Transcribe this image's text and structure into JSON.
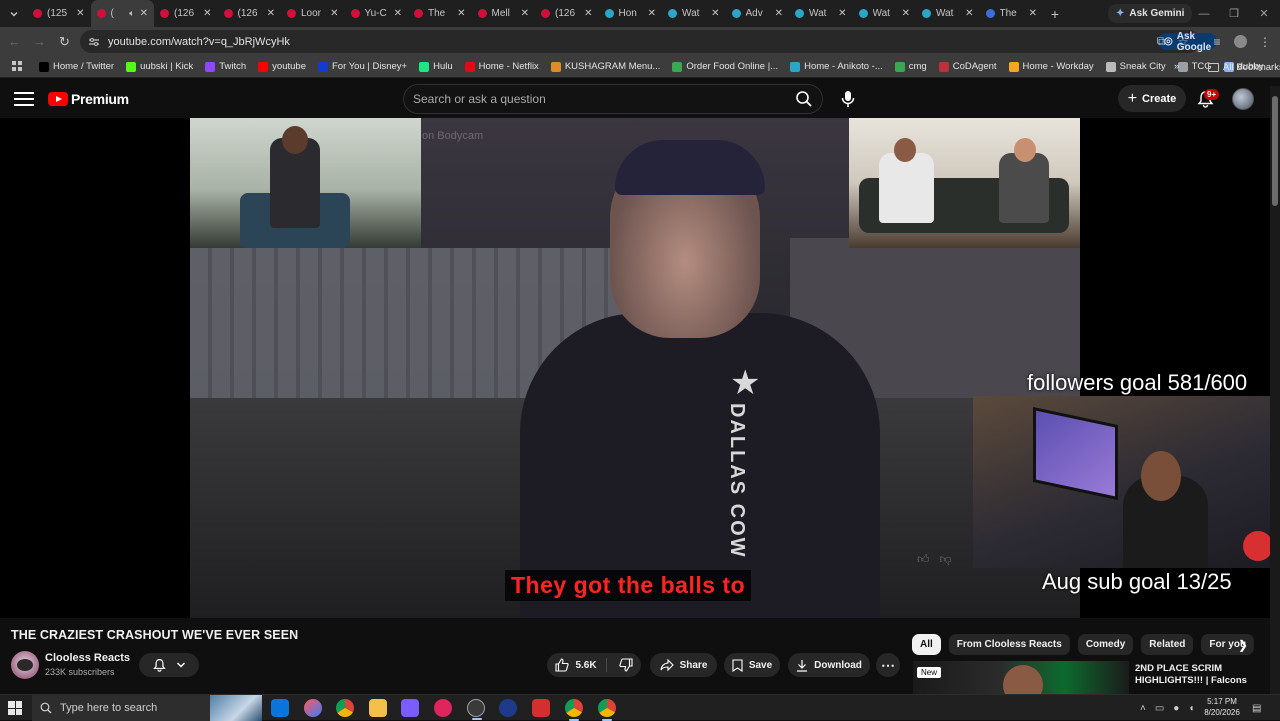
{
  "browser": {
    "tabs": [
      {
        "title": "(125",
        "fav": "#d0103a",
        "active": false
      },
      {
        "title": "(",
        "fav": "#d0103a",
        "active": true
      },
      {
        "title": "(126",
        "fav": "#d0103a",
        "active": false
      },
      {
        "title": "(126",
        "fav": "#d0103a",
        "active": false
      },
      {
        "title": "Loor",
        "fav": "#d0103a",
        "active": false
      },
      {
        "title": "Yu-C",
        "fav": "#d0103a",
        "active": false
      },
      {
        "title": "The",
        "fav": "#d0103a",
        "active": false
      },
      {
        "title": "Mell",
        "fav": "#d0103a",
        "active": false
      },
      {
        "title": "(126",
        "fav": "#d0103a",
        "active": false
      },
      {
        "title": "Hon",
        "fav": "#2aa6c9",
        "active": false
      },
      {
        "title": "Wat",
        "fav": "#2aa6c9",
        "active": false
      },
      {
        "title": "Adv",
        "fav": "#2aa6c9",
        "active": false
      },
      {
        "title": "Wat",
        "fav": "#2aa6c9",
        "active": false
      },
      {
        "title": "Wat",
        "fav": "#2aa6c9",
        "active": false
      },
      {
        "title": "Wat",
        "fav": "#2aa6c9",
        "active": false
      },
      {
        "title": "The",
        "fav": "#3b6fe0",
        "active": false
      }
    ],
    "ask_gemini": "Ask Gemini",
    "url": "youtube.com/watch?v=q_JbRjWcyHk",
    "ask_google": "Ask Google",
    "bookmarks": [
      {
        "label": "Home / Twitter",
        "color": "#000000"
      },
      {
        "label": "uubski | Kick",
        "color": "#53fc18"
      },
      {
        "label": "Twitch",
        "color": "#9146ff"
      },
      {
        "label": "youtube",
        "color": "#ff0000"
      },
      {
        "label": "For You | Disney+",
        "color": "#113ccf"
      },
      {
        "label": "Hulu",
        "color": "#1ce783"
      },
      {
        "label": "Home - Netflix",
        "color": "#e50914"
      },
      {
        "label": "KUSHAGRAM Menu...",
        "color": "#e08a2a"
      },
      {
        "label": "Order Food Online |...",
        "color": "#3aa84f"
      },
      {
        "label": "Home - Anikoto -...",
        "color": "#2aa6c9"
      },
      {
        "label": "cmg",
        "color": "#3aa84f"
      },
      {
        "label": "CoDAgent",
        "color": "#c0303a"
      },
      {
        "label": "Home - Workday",
        "color": "#f5a623"
      },
      {
        "label": "Sneak City",
        "color": "#bbbbbb"
      },
      {
        "label": "TCG",
        "color": "#9aa0a6"
      },
      {
        "label": "dubby",
        "color": "#8ab4f8"
      }
    ],
    "all_bookmarks": "All Bookmarks"
  },
  "youtube": {
    "logo_text": "Premium",
    "search_placeholder": "Search or ask a question",
    "create_label": "Create",
    "notif_count": "9+",
    "video": {
      "watermark": "on Bodycam",
      "subtitle": "They got the balls to",
      "jersey": "DALLAS COW",
      "followers_goal": "followers goal 581/600",
      "sub_goal": "Aug sub goal 13/25"
    },
    "title": "THE CRAZIEST CRASHOUT WE'VE EVER SEEN",
    "channel": {
      "name": "Clooless Reacts",
      "subscribers": "233K subscribers"
    },
    "actions": {
      "likes": "5.6K",
      "share": "Share",
      "save": "Save",
      "download": "Download"
    },
    "chips": [
      "All",
      "From Clooless Reacts",
      "Comedy",
      "Related",
      "For you"
    ],
    "recommended": {
      "badge": "New",
      "title": "2ND PLACE SCRIM HIGHLIGHTS!!! | Falcons"
    }
  },
  "taskbar": {
    "search_placeholder": "Type here to search",
    "time": "5:17 PM",
    "date": "8/20/2026"
  }
}
